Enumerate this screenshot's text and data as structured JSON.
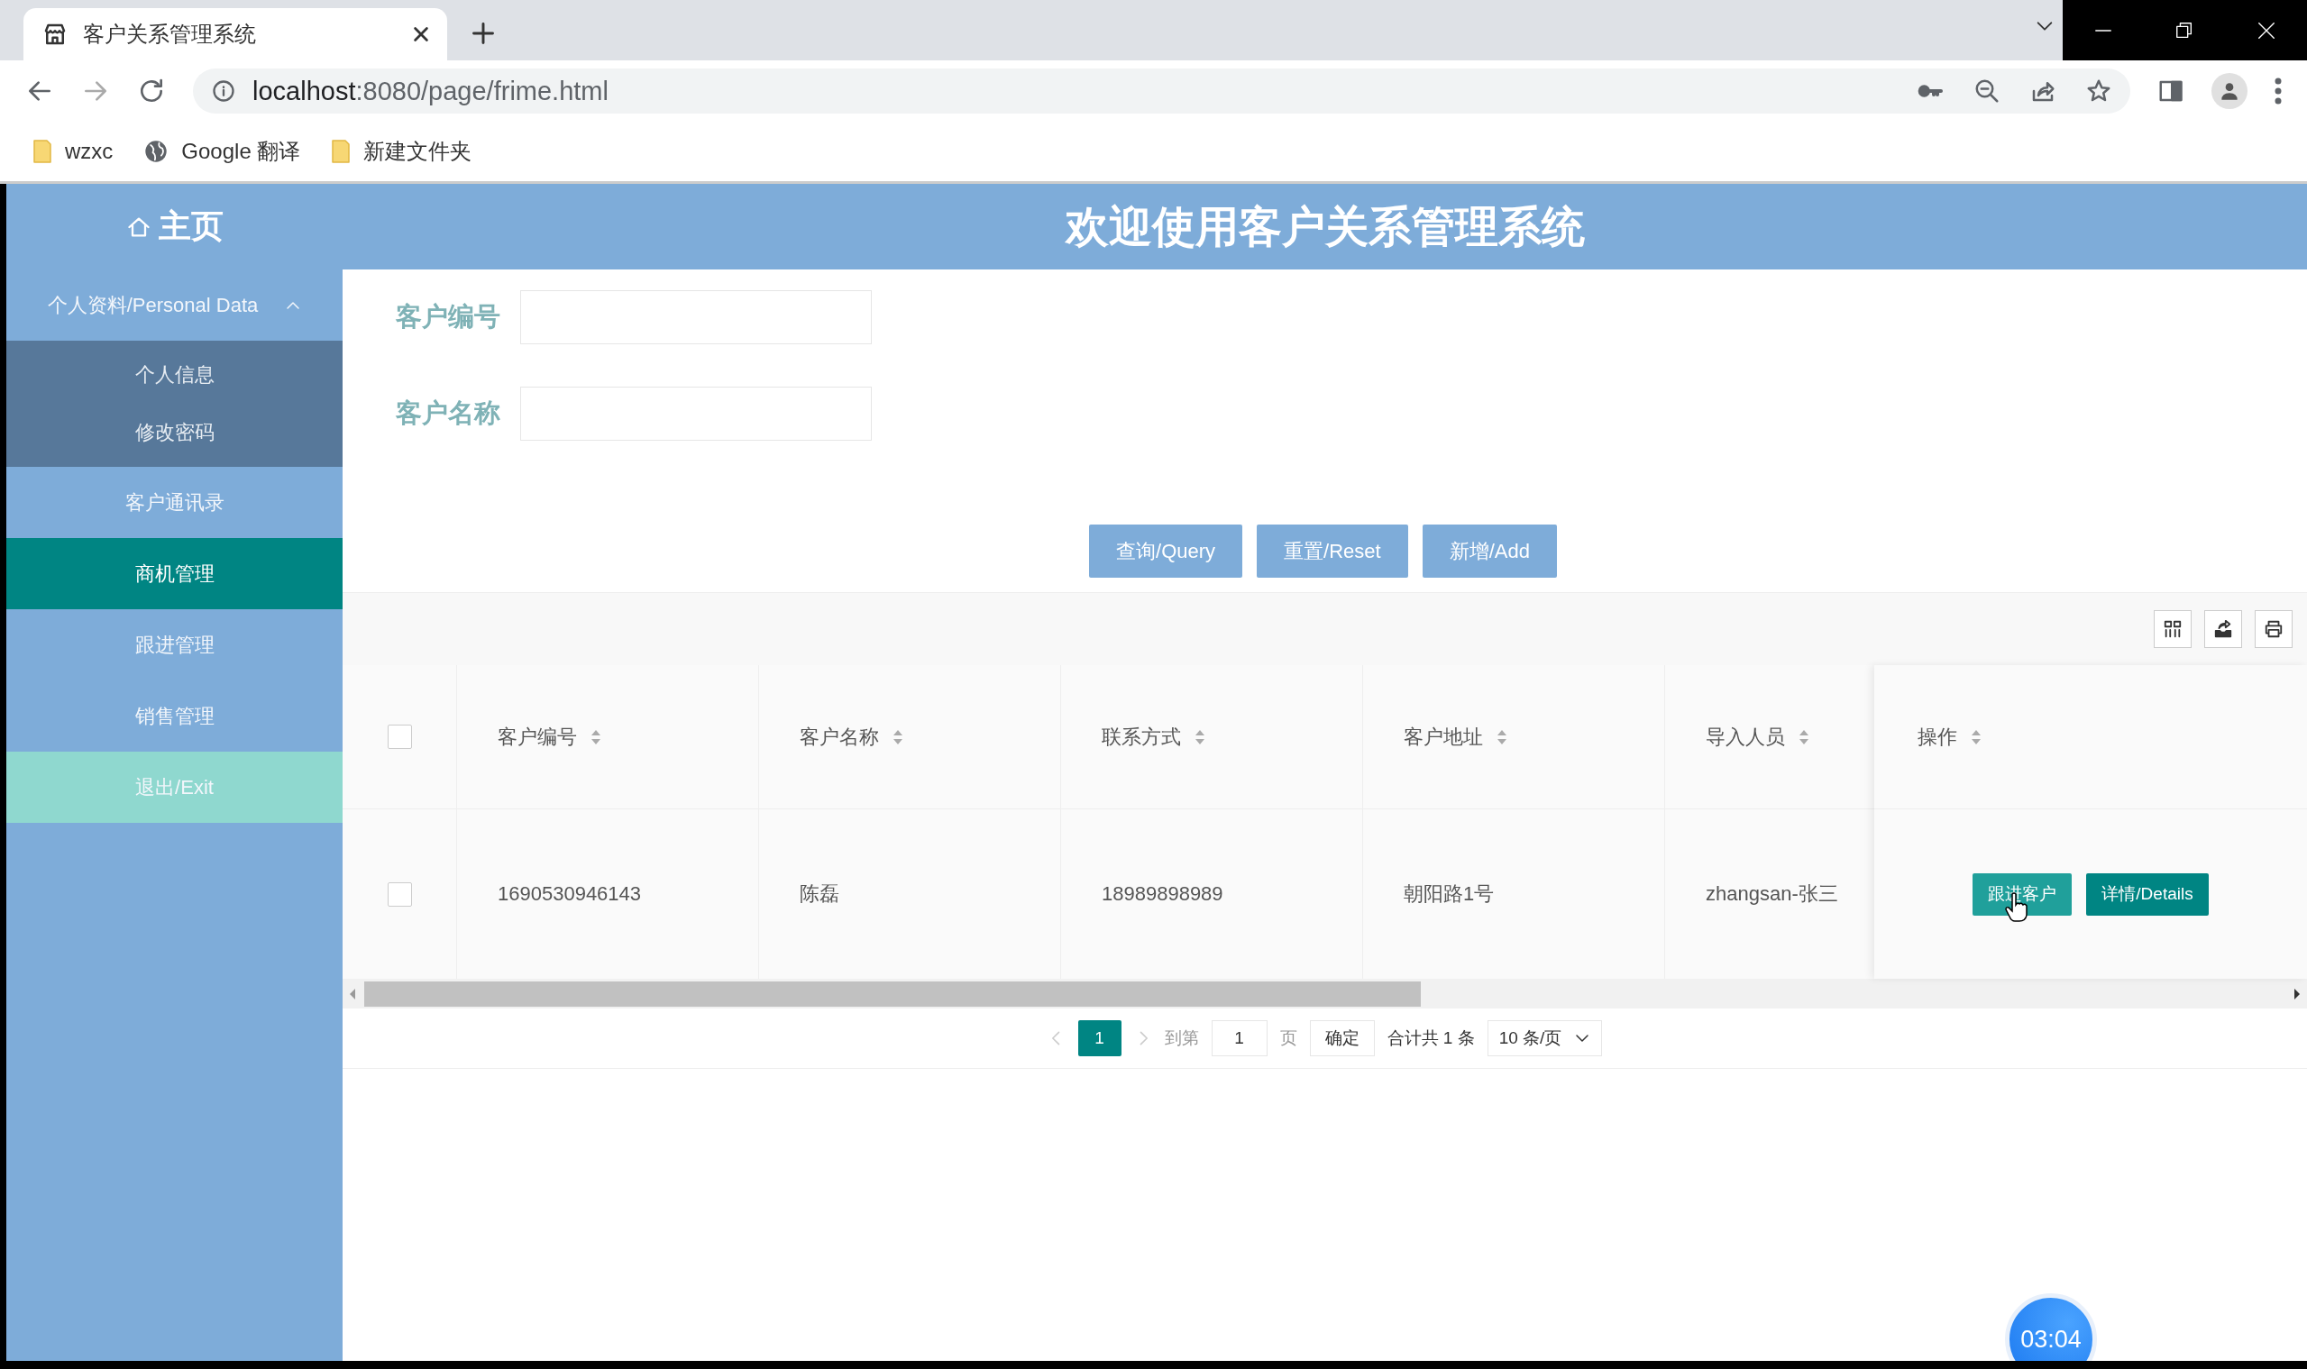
{
  "browser": {
    "tab": {
      "title": "客户关系管理系统"
    },
    "url": {
      "host": "localhost",
      "rest": ":8080/page/frime.html"
    },
    "bookmarks": [
      {
        "kind": "folder",
        "label": "wzxc"
      },
      {
        "kind": "globe",
        "label": "Google 翻译"
      },
      {
        "kind": "folder",
        "label": "新建文件夹"
      }
    ]
  },
  "header": {
    "home": "主页",
    "title": "欢迎使用客户关系管理系统"
  },
  "sidebar": {
    "items": [
      {
        "kind": "group",
        "label": "个人资料/Personal Data",
        "expanded": true,
        "selected": false,
        "children": [
          {
            "label": "个人信息",
            "selected": false
          },
          {
            "label": "修改密码",
            "selected": false
          }
        ]
      },
      {
        "kind": "item",
        "label": "客户通讯录",
        "selected": false
      },
      {
        "kind": "item",
        "label": "商机管理",
        "selected": true
      },
      {
        "kind": "item",
        "label": "跟进管理",
        "selected": false
      },
      {
        "kind": "item",
        "label": "销售管理",
        "selected": false
      },
      {
        "kind": "exit",
        "label": "退出/Exit",
        "selected": false
      }
    ]
  },
  "search": {
    "fields": [
      {
        "label": "客户编号"
      },
      {
        "label": "客户名称"
      }
    ],
    "buttons": [
      "查询/Query",
      "重置/Reset",
      "新增/Add"
    ]
  },
  "table": {
    "select_all": {
      "checked": false
    },
    "columns": [
      "客户编号",
      "客户名称",
      "联系方式",
      "客户地址",
      "导入人员",
      "操作"
    ],
    "rows": [
      {
        "checked": false,
        "cells": [
          "1690530946143",
          "陈磊",
          "18989898989",
          "朝阳路1号",
          "zhangsan-张三"
        ],
        "actions": [
          {
            "kind": "follow",
            "label": "跟进客户"
          },
          {
            "kind": "details",
            "label": "详情/Details"
          }
        ]
      }
    ]
  },
  "pagination": {
    "pages": [
      {
        "label": "1",
        "selected": true
      }
    ],
    "goto_label": "到第",
    "goto_value": "1",
    "page_label": "页",
    "confirm": "确定",
    "total": "合计共 1 条",
    "page_size": "10 条/页"
  },
  "recording_timer": "03:04"
}
